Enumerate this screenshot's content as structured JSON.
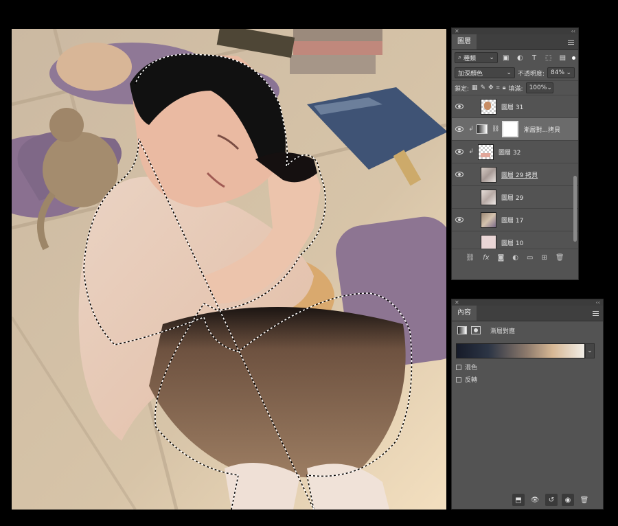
{
  "layers_panel": {
    "tab": "圖層",
    "filter": {
      "kind": "種類",
      "icons": [
        "image-filter-icon",
        "adjustment-filter-icon",
        "type-filter-icon",
        "shape-filter-icon",
        "smart-object-filter-icon"
      ]
    },
    "blend_mode": "加深顏色",
    "opacity_label": "不透明度:",
    "opacity_value": "84%",
    "lock_label": "鎖定:",
    "fill_label": "填滿:",
    "fill_value": "100%",
    "layers": [
      {
        "name": "圖層 31",
        "visible": true,
        "thumb": "checker-art"
      },
      {
        "name": "漸層對...拷貝",
        "visible": true,
        "selected": true,
        "clipped": true,
        "thumb": "adjustment-mask"
      },
      {
        "name": "圖層 32",
        "visible": true,
        "clipped": true,
        "thumb": "checker-pink"
      },
      {
        "name": "圖層 29 拷貝",
        "visible": true,
        "thumb": "photo-1"
      },
      {
        "name": "圖層 29",
        "visible": false,
        "thumb": "photo-2"
      },
      {
        "name": "圖層 17",
        "visible": true,
        "thumb": "photo-3"
      },
      {
        "name": "圖層 10",
        "visible": false,
        "thumb": "pink-fill"
      }
    ],
    "footer_icons": [
      "link-icon",
      "fx-icon",
      "mask-icon",
      "adjustment-icon",
      "folder-icon",
      "new-layer-icon",
      "trash-icon"
    ]
  },
  "properties_panel": {
    "tab": "內容",
    "title": "漸層對應",
    "dither_label": "混色",
    "reverse_label": "反轉",
    "footer_icons": [
      "clip-to-layer-icon",
      "view-previous-icon",
      "reset-icon",
      "visibility-icon",
      "trash-icon"
    ]
  },
  "colors": {
    "panel_bg": "#535353",
    "gradient": [
      "#161b29",
      "#2c3545",
      "#8d7a6c",
      "#d6b794",
      "#f1ede6"
    ]
  }
}
